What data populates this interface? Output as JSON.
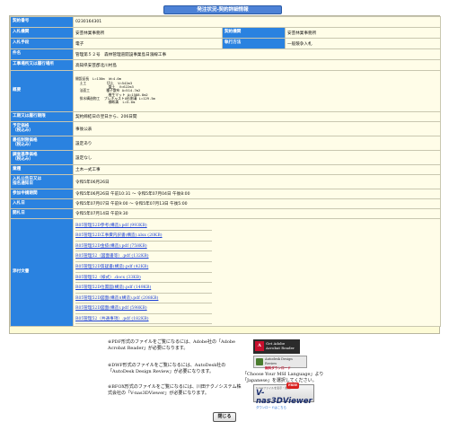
{
  "title": "発注状況-契約詳細情報",
  "rows": {
    "contract_no": {
      "label": "契約番号",
      "value": "0230164301"
    },
    "org": {
      "label": "入札機関",
      "value": "安芸林業事務所",
      "label2": "契約機関",
      "value2": "安芸林業事務所"
    },
    "method": {
      "label": "入札手段",
      "value": "電子",
      "label2": "執行方法",
      "value2": "一般競争入札"
    },
    "subject": {
      "label": "件名",
      "value": "管理第５２号　森林管理道開設事業島日濱線工事"
    },
    "place": {
      "label": "工事場所又は履行場所",
      "value": "高知県安芸郡北川村島"
    },
    "summary": {
      "label": "概要",
      "value": "開設延長　L=130m  W=4.0m\n  土工          切土  V=542m3\n                盛土  V=622m3\n  法面工        種子散布 A=514.7m2\n                植生マット A=1588.8m2\n  排水構造物工  プレキャストU形側溝 L=129.5m\n                横断溝  L=5.0m"
    },
    "period": {
      "label": "工期又は履行期限",
      "value": "契約締結日の翌日から、206日間"
    },
    "budget": {
      "label": "予定価格\n（税込み）",
      "value": "事後公表"
    },
    "min_price": {
      "label": "最低制限価格\n（税込み）",
      "value": "設定あり"
    },
    "survey_price": {
      "label": "調査基準価格\n（税込み）",
      "value": "設定なし"
    },
    "category": {
      "label": "業種",
      "value": "土木一式工事"
    },
    "notice_date": {
      "label": "入札公告日又は\n指名通知日",
      "value": "令和5年06月26日"
    },
    "apply_period": {
      "label": "参加申請期間",
      "value": "令和5年06月26日 午前10:31 ～ 令和5年07月04日 午後8:00"
    },
    "bid_period": {
      "label": "入札日",
      "value": "令和5年07月07日 午前9:00 ～ 令和5年07月13日 午後5:00"
    },
    "open_date": {
      "label": "開札日",
      "value": "令和5年07月14日 午前9:30"
    },
    "attachments": {
      "label": "添付文書",
      "files": [
        "R05管理52D参考(構造).pdf (993KB)",
        "R05管理52D工事費内訳書(構造).xlsx (20KB)",
        "R05管理52D金抜(構造).pdf (758KB)",
        "R05管理52（図面書等）.pdf (132KB)",
        "R05管理52D質疑書(構造).pdf (42KB)",
        "R05管理52（様式）.docx (33KB)",
        "R05管理52D位置図(構造).pdf (149KB)",
        "R05管理52D図面(構造)(構造).pdf (208KB)",
        "R05管理52D図面(構造).pdf (598KB)",
        "R05管理52（共通事項）.pdf (182KB)"
      ]
    }
  },
  "notes": {
    "pdf": "※PDF形式のファイルをご覧になるには、Adobe社の「Adobe Acrobat Reader」が必要になります。",
    "dwf": "※DWF形式のファイルをご覧になるには、AutoDesk社の「AutoDesk Design Review」が必要になります。",
    "dwf2": "「Choose Your MSI Language」より「Japanese」を選択してください。",
    "bfo": "※BFOX形式のファイルをご覧になるには、川田テクノシステム株式会社の「V-nas3DViewer」が必要になります。"
  },
  "badges": {
    "adobe_line1": "Get Adobe",
    "adobe_line2": "Acrobat Reader",
    "autodesk_line1": "Autodesk Design Review",
    "autodesk_line2": "無料ダウンロード",
    "vnas_tiny": "V-nasファイルを表示・閲覧！",
    "vnas_big": "V-nas3DViewer",
    "vnas_sub": "ダウンロードはこちら",
    "vnas_free": "FREE"
  },
  "close_label": "閉じる"
}
